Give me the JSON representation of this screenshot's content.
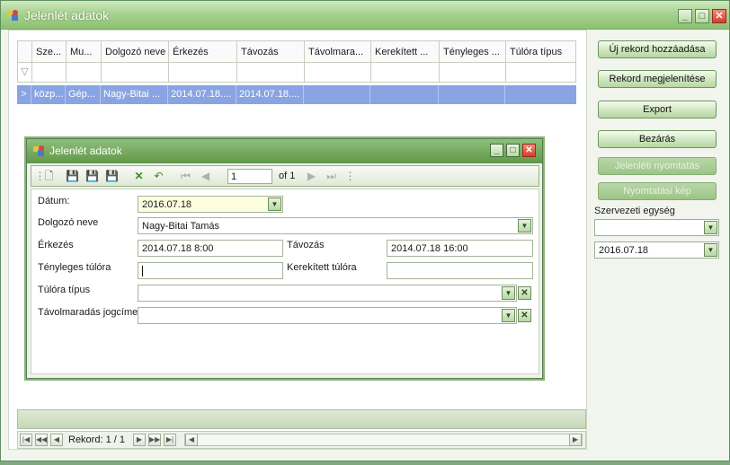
{
  "window": {
    "title": "Jelenlét adatok",
    "minimize": "_",
    "maximize": "□",
    "close": "✕"
  },
  "grid": {
    "columns": [
      "Sze...",
      "Mu...",
      "Dolgozó neve",
      "Érkezés",
      "Távozás",
      "Távolmara...",
      "Kerekített ...",
      "Tényleges ...",
      "Túlóra típus"
    ],
    "row": [
      "közp...",
      "Gép...",
      "Nagy-Bitai ...",
      "2014.07.18....",
      "2014.07.18....",
      "",
      "",
      "",
      ""
    ],
    "filter_icon": "▽",
    "row_indicator": ">"
  },
  "navigator": {
    "first": "|◀",
    "prev_page": "◀◀",
    "prev": "◀",
    "record_text": "Rekord: 1 / 1",
    "next": "▶",
    "next_page": "▶▶",
    "last": "▶|",
    "scroll_left": "◀",
    "scroll_right": "▶"
  },
  "actions": {
    "new_record": "Új rekord hozzáadása",
    "show_record": "Rekord megjelenítése",
    "export": "Export",
    "close": "Bezárás",
    "print_attendance": "Jelenléti nyomtatás",
    "print_preview": "Nyomtatási kép"
  },
  "filters": {
    "org_unit_label": "Szervezeti egység",
    "org_unit_value": "",
    "date_value": "2016.07.18"
  },
  "dialog": {
    "title": "Jelenlét adatok",
    "page_input": "1",
    "page_of": "of 1",
    "fields": {
      "datum_label": "Dátum:",
      "datum_value": "2016.07.18",
      "dolgozo_label": "Dolgozó neve",
      "dolgozo_value": "Nagy-Bitai Tamás",
      "erkezes_label": "Érkezés",
      "erkezes_value": "2014.07.18 8:00",
      "tavozas_label": "Távozás",
      "tavozas_value": "2014.07.18 16:00",
      "tenyleges_label": "Tényleges túlóra",
      "tenyleges_value": "",
      "kerekitett_label": "Kerekített túlóra",
      "kerekitett_value": "",
      "tulora_tipus_label": "Túlóra típus",
      "tulora_tipus_value": "",
      "tavolmaradas_label": "Távolmaradás jogcíme",
      "tavolmaradas_value": ""
    }
  },
  "colors": {
    "selected_row": "#89a4e3",
    "title_green": "#8dc072",
    "button_green": "#cfe6c0"
  }
}
